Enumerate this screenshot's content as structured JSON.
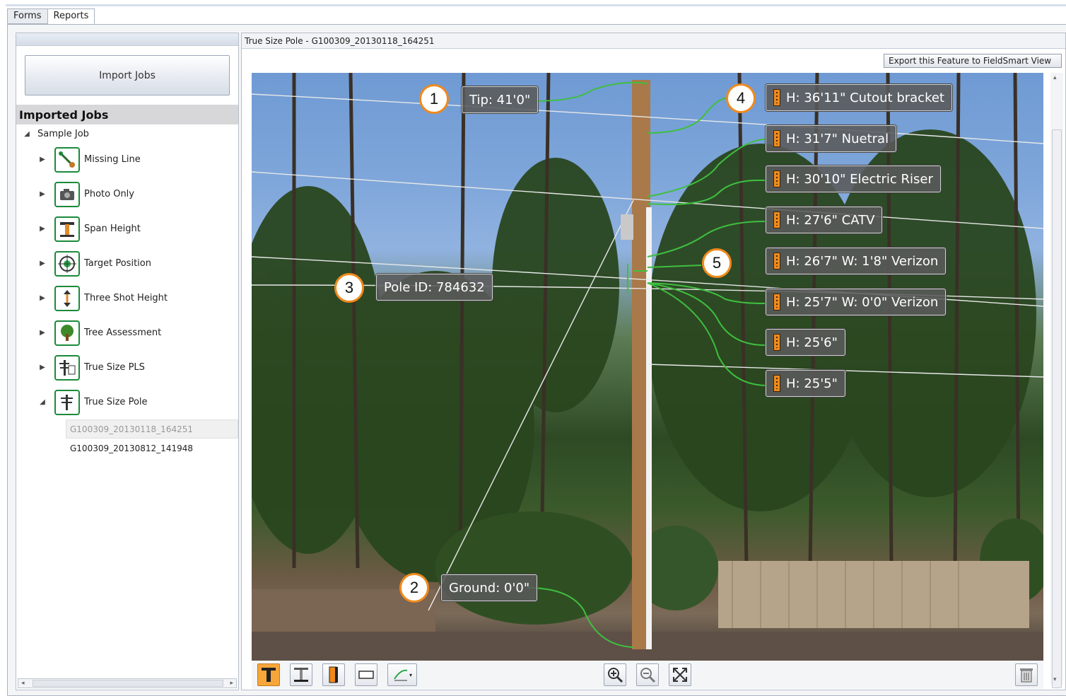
{
  "tabs": [
    {
      "label": "Forms"
    },
    {
      "label": "Reports"
    }
  ],
  "left": {
    "import_button": "Import Jobs",
    "imported_title": "Imported Jobs",
    "root": "Sample Job",
    "items": [
      {
        "label": "Missing Line",
        "icon": "missing-line-icon"
      },
      {
        "label": "Photo Only",
        "icon": "camera-icon"
      },
      {
        "label": "Span Height",
        "icon": "span-height-icon"
      },
      {
        "label": "Target Position",
        "icon": "target-icon"
      },
      {
        "label": "Three Shot Height",
        "icon": "three-shot-height-icon"
      },
      {
        "label": "Tree Assessment",
        "icon": "tree-icon"
      },
      {
        "label": "True Size PLS",
        "icon": "pls-icon"
      },
      {
        "label": "True Size Pole",
        "icon": "pole-icon"
      }
    ],
    "leaves": [
      {
        "label": "G100309_20130118_164251"
      },
      {
        "label": "G100309_20130812_141948"
      }
    ]
  },
  "right": {
    "title": "True Size Pole - G100309_20130118_164251",
    "export_button": "Export this Feature to FieldSmart View"
  },
  "annotations": [
    {
      "text": "Tip: 41'0\""
    },
    {
      "text": "Ground: 0'0\""
    },
    {
      "text": "Pole ID: 784632"
    },
    {
      "text": "H: 36'11\" Cutout bracket"
    },
    {
      "text": "H: 31'7\" Nuetral"
    },
    {
      "text": "H: 30'10\" Electric Riser"
    },
    {
      "text": "H: 27'6\" CATV"
    },
    {
      "text": "H: 26'7\" W: 1'8\" Verizon"
    },
    {
      "text": "H: 25'7\" W: 0'0\" Verizon"
    },
    {
      "text": "H: 25'6\""
    },
    {
      "text": "H: 25'5\""
    }
  ],
  "callouts": [
    "1",
    "2",
    "3",
    "4",
    "5"
  ],
  "colors": {
    "accent": "#f08a1c",
    "icon_frame": "#1b8a3a",
    "leader": "#3fbf3f"
  }
}
